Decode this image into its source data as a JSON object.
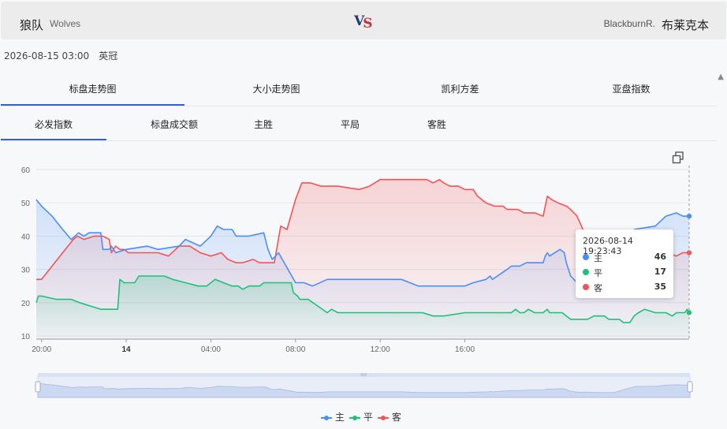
{
  "header": {
    "home_cn": "狼队",
    "home_en": "Wolves",
    "vs_v": "V",
    "vs_s": "S",
    "away_en": "BlackburnR.",
    "away_cn": "布莱克本"
  },
  "meta": {
    "datetime": "2026-08-15 03:00",
    "league": "英冠"
  },
  "tabs_primary": [
    "标盘走势图",
    "大小走势图",
    "凯利方差",
    "亚盘指数"
  ],
  "tabs_secondary": [
    "必发指数",
    "标盘成交额",
    "主胜",
    "平局",
    "客胜"
  ],
  "tooltip": {
    "time": "2026-08-14 19:23:43",
    "rows": [
      {
        "name": "主",
        "value": "46"
      },
      {
        "name": "平",
        "value": "17"
      },
      {
        "name": "客",
        "value": "35"
      }
    ]
  },
  "colors": {
    "home": "#4a8ef5",
    "draw": "#1ec07a",
    "away": "#f45353",
    "tab_active": "#3a5fcd"
  },
  "chart_data": {
    "type": "line",
    "y_ticks": [
      "60",
      "50",
      "40",
      "30",
      "20",
      "10"
    ],
    "ylim": [
      10,
      60
    ],
    "x_range_hours": [
      19.75,
      19.6
    ],
    "x_ticks": [
      {
        "label": "20:00",
        "x": 20
      },
      {
        "label": "14",
        "x": 24,
        "bold": true
      },
      {
        "label": "04:00",
        "x": 28
      },
      {
        "label": "08:00",
        "x": 32
      },
      {
        "label": "12:00",
        "x": 36
      },
      {
        "label": "16:00",
        "x": 40
      }
    ],
    "grid": true,
    "legend_position": "bottom-center",
    "series": [
      {
        "name": "主",
        "color": "#4a8ef5",
        "points": [
          [
            19.75,
            51
          ],
          [
            20,
            49
          ],
          [
            20.5,
            46
          ],
          [
            21,
            42
          ],
          [
            21.4,
            39
          ],
          [
            21.75,
            41
          ],
          [
            22,
            40
          ],
          [
            22.25,
            41
          ],
          [
            22.8,
            41
          ],
          [
            22.9,
            36
          ],
          [
            23.2,
            36
          ],
          [
            23.3,
            37
          ],
          [
            23.5,
            35
          ],
          [
            24,
            36
          ],
          [
            25,
            37
          ],
          [
            25.5,
            36
          ],
          [
            26.5,
            37
          ],
          [
            26.8,
            39
          ],
          [
            27.5,
            37
          ],
          [
            28,
            40
          ],
          [
            28.3,
            43
          ],
          [
            28.6,
            42
          ],
          [
            29,
            42
          ],
          [
            29.2,
            40
          ],
          [
            29.8,
            40
          ],
          [
            30.5,
            41
          ],
          [
            30.7,
            36
          ],
          [
            30.9,
            33
          ],
          [
            31.2,
            35
          ],
          [
            32,
            26
          ],
          [
            32.4,
            26
          ],
          [
            32.8,
            25
          ],
          [
            33.5,
            27
          ],
          [
            35,
            27
          ],
          [
            37,
            27
          ],
          [
            37.8,
            25
          ],
          [
            38.5,
            25
          ],
          [
            40,
            25
          ],
          [
            40.4,
            26
          ],
          [
            41,
            27
          ],
          [
            41.2,
            28
          ],
          [
            41.3,
            27
          ],
          [
            42,
            30
          ],
          [
            42.2,
            31
          ],
          [
            42.6,
            31
          ],
          [
            42.9,
            32
          ],
          [
            43.2,
            32
          ],
          [
            43.7,
            32
          ],
          [
            43.8,
            34
          ],
          [
            43.9,
            35
          ],
          [
            44,
            34
          ],
          [
            44.5,
            36
          ],
          [
            44.7,
            35
          ],
          [
            44.8,
            32
          ],
          [
            45,
            28
          ],
          [
            45.3,
            26
          ],
          [
            45.8,
            26
          ],
          [
            46.2,
            25
          ],
          [
            46.7,
            25
          ],
          [
            47,
            25
          ],
          [
            48,
            42
          ],
          [
            49,
            43
          ],
          [
            49.5,
            46
          ],
          [
            50,
            47
          ],
          [
            50.3,
            46
          ],
          [
            50.6,
            46
          ]
        ]
      },
      {
        "name": "平",
        "color": "#1ec07a",
        "points": [
          [
            19.75,
            20
          ],
          [
            19.85,
            22
          ],
          [
            20,
            22
          ],
          [
            20.7,
            21
          ],
          [
            21.4,
            21
          ],
          [
            21.8,
            20
          ],
          [
            22.3,
            19
          ],
          [
            22.8,
            18
          ],
          [
            23.6,
            18
          ],
          [
            23.7,
            27
          ],
          [
            23.9,
            26
          ],
          [
            24.4,
            26
          ],
          [
            24.6,
            28
          ],
          [
            25.8,
            28
          ],
          [
            26.2,
            27
          ],
          [
            26.8,
            26
          ],
          [
            27.4,
            25
          ],
          [
            27.8,
            25
          ],
          [
            28.2,
            27
          ],
          [
            28.6,
            26
          ],
          [
            29,
            25
          ],
          [
            29.3,
            25
          ],
          [
            29.5,
            24
          ],
          [
            29.8,
            25
          ],
          [
            30.3,
            25
          ],
          [
            30.5,
            26
          ],
          [
            31.8,
            26
          ],
          [
            31.9,
            23
          ],
          [
            32.1,
            22
          ],
          [
            32.2,
            21
          ],
          [
            32.6,
            21
          ],
          [
            33.5,
            17
          ],
          [
            33.7,
            18
          ],
          [
            34,
            17
          ],
          [
            38,
            17
          ],
          [
            38.5,
            16
          ],
          [
            39,
            16
          ],
          [
            40,
            17
          ],
          [
            42.2,
            17
          ],
          [
            42.4,
            18
          ],
          [
            42.6,
            17
          ],
          [
            42.8,
            17
          ],
          [
            43,
            18
          ],
          [
            43.3,
            17
          ],
          [
            43.7,
            17
          ],
          [
            43.9,
            18
          ],
          [
            44,
            17
          ],
          [
            44.6,
            17
          ],
          [
            44.8,
            16
          ],
          [
            45,
            15
          ],
          [
            45.8,
            15
          ],
          [
            46.1,
            16
          ],
          [
            46.6,
            16
          ],
          [
            46.8,
            15
          ],
          [
            47.3,
            15
          ],
          [
            47.5,
            14
          ],
          [
            47.8,
            14
          ],
          [
            48,
            16
          ],
          [
            48.2,
            17
          ],
          [
            48.5,
            18
          ],
          [
            49,
            17
          ],
          [
            49.5,
            17
          ],
          [
            49.8,
            16
          ],
          [
            50,
            17
          ],
          [
            50.4,
            17
          ],
          [
            50.5,
            18
          ],
          [
            50.6,
            17
          ]
        ]
      },
      {
        "name": "客",
        "color": "#f45353",
        "points": [
          [
            19.75,
            27
          ],
          [
            20,
            27
          ],
          [
            20.5,
            31
          ],
          [
            21,
            35
          ],
          [
            21.5,
            39
          ],
          [
            21.7,
            40
          ],
          [
            22,
            39
          ],
          [
            22.5,
            40
          ],
          [
            22.9,
            40
          ],
          [
            23.2,
            39
          ],
          [
            23.3,
            35
          ],
          [
            23.5,
            37
          ],
          [
            23.7,
            36
          ],
          [
            23.9,
            36
          ],
          [
            24.1,
            35
          ],
          [
            24.5,
            35
          ],
          [
            25,
            35
          ],
          [
            25.5,
            35
          ],
          [
            26,
            34
          ],
          [
            26.5,
            37
          ],
          [
            27,
            37
          ],
          [
            27.5,
            35
          ],
          [
            28,
            34
          ],
          [
            28.5,
            35
          ],
          [
            28.8,
            33
          ],
          [
            29.2,
            32
          ],
          [
            29.5,
            32
          ],
          [
            30,
            33
          ],
          [
            30.3,
            32
          ],
          [
            30.6,
            32
          ],
          [
            31,
            32
          ],
          [
            31.3,
            43
          ],
          [
            31.6,
            42
          ],
          [
            32,
            51
          ],
          [
            32.3,
            56
          ],
          [
            32.7,
            56
          ],
          [
            33.2,
            55
          ],
          [
            34,
            55
          ],
          [
            35,
            54
          ],
          [
            35.5,
            55
          ],
          [
            36,
            57
          ],
          [
            37,
            57
          ],
          [
            38.2,
            57
          ],
          [
            38.5,
            56
          ],
          [
            38.8,
            57
          ],
          [
            39,
            56
          ],
          [
            39.3,
            55
          ],
          [
            39.7,
            55
          ],
          [
            40,
            54
          ],
          [
            40.4,
            54
          ],
          [
            40.6,
            52
          ],
          [
            41,
            50
          ],
          [
            41.4,
            49
          ],
          [
            41.8,
            49
          ],
          [
            42,
            48
          ],
          [
            42.5,
            48
          ],
          [
            42.8,
            47
          ],
          [
            43.3,
            47
          ],
          [
            43.7,
            46
          ],
          [
            43.9,
            52
          ],
          [
            44.1,
            51
          ],
          [
            44.4,
            50
          ],
          [
            44.8,
            49
          ],
          [
            45,
            48
          ],
          [
            45.3,
            46
          ],
          [
            46,
            36
          ],
          [
            47,
            37
          ],
          [
            48.5,
            37
          ],
          [
            49.2,
            36
          ],
          [
            50,
            34
          ],
          [
            50.3,
            35
          ],
          [
            50.6,
            35
          ]
        ]
      }
    ]
  }
}
